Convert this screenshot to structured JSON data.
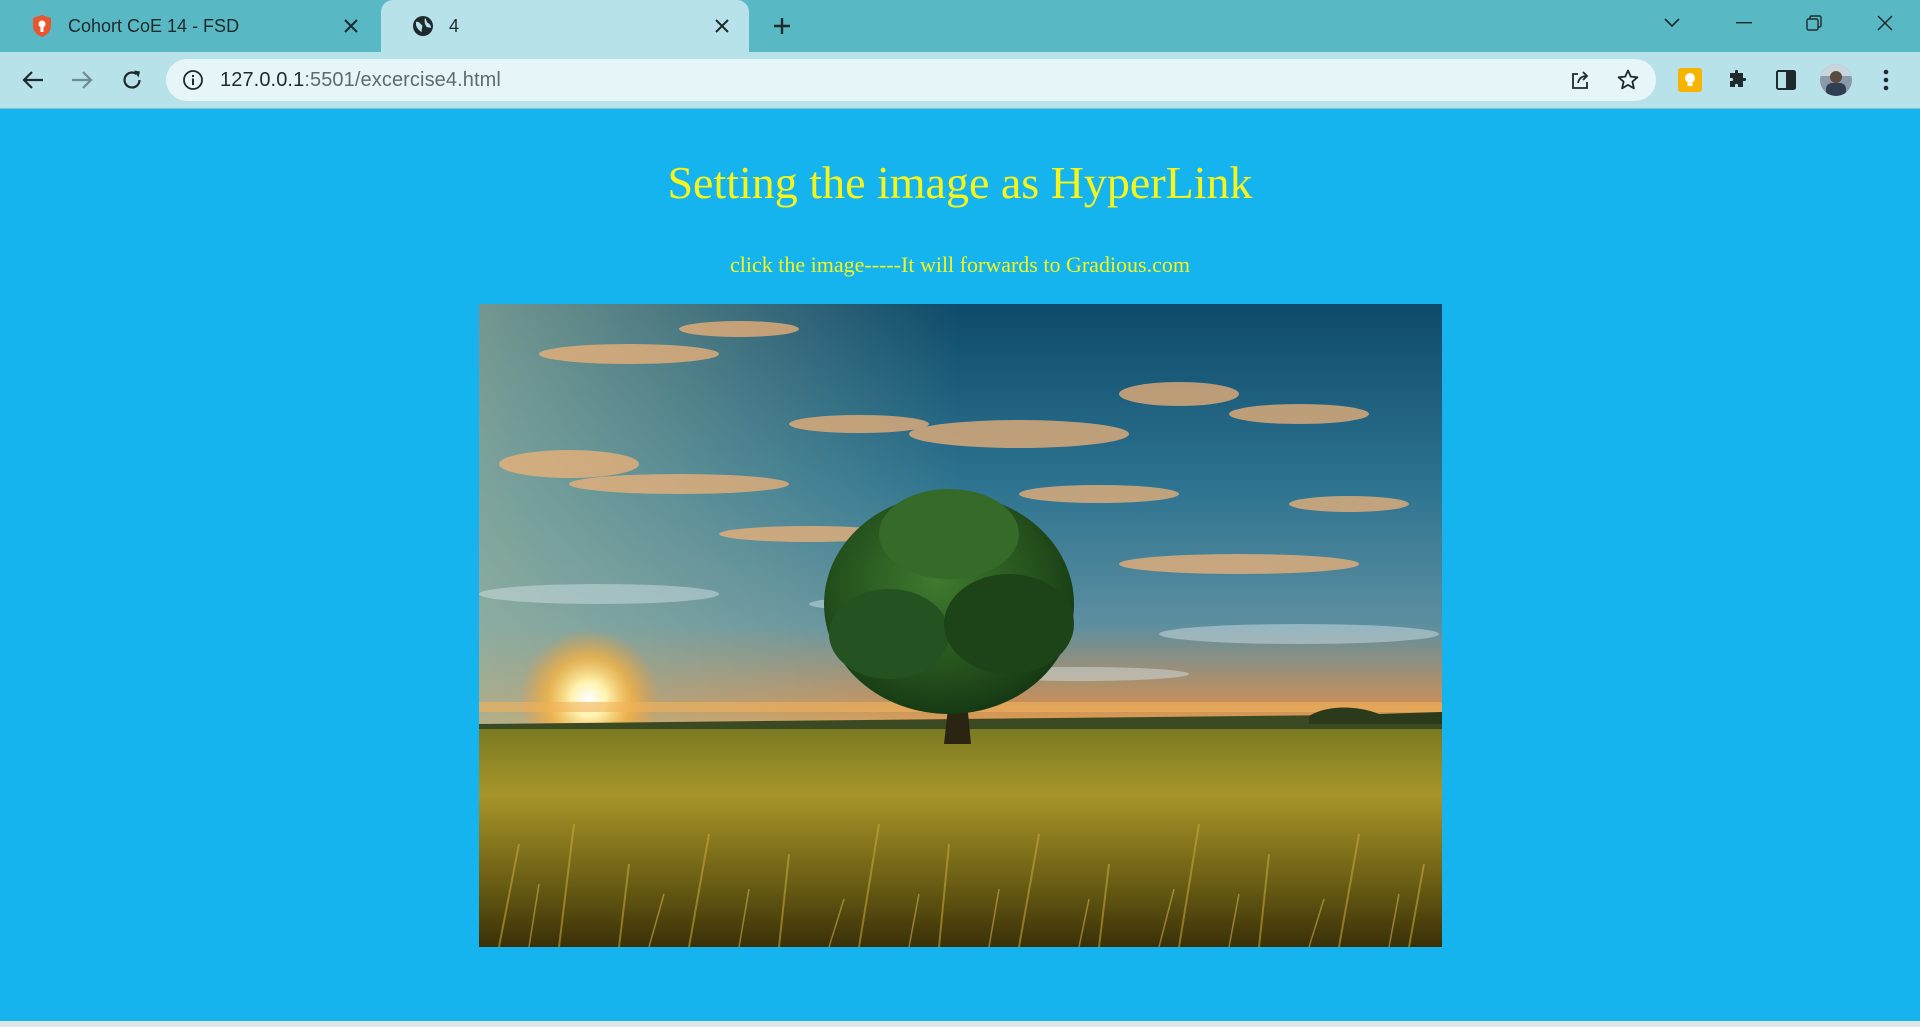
{
  "browser": {
    "tabs": [
      {
        "title": "Cohort CoE 14 - FSD",
        "icon": "shield-favicon-icon",
        "active": false
      },
      {
        "title": "4",
        "icon": "globe-icon",
        "active": true
      }
    ],
    "address": {
      "host": "127.0.0.1",
      "rest": ":5501/excercise4.html"
    },
    "accent": "#58b8c4",
    "toolbar_color": "#b8e2ea"
  },
  "page": {
    "background": "#16b4ee",
    "text_color": "#f6f51c",
    "heading": "Setting the image as HyperLink",
    "caption": "click the image-----It will forwards to Gradious.com",
    "image": {
      "link_target": "Gradious.com",
      "subject": "sunset-field-tree"
    }
  }
}
